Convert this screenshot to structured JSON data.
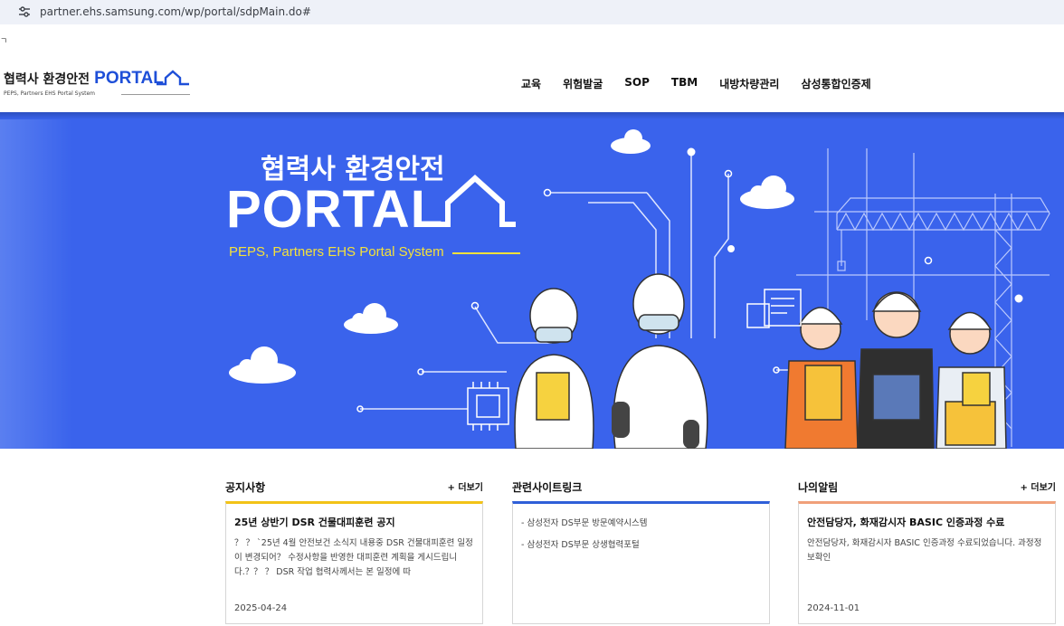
{
  "browser": {
    "url": "partner.ehs.samsung.com/wp/portal/sdpMain.do#",
    "bookmark_fragment": "ㄱ"
  },
  "header": {
    "logo_ko": "협력사 환경안전",
    "logo_portal": "PORTAL",
    "logo_sub": "PEPS, Partners EHS Portal System",
    "nav": [
      "교육",
      "위험발굴",
      "SOP",
      "TBM",
      "내방차량관리",
      "삼성통합인증제"
    ]
  },
  "hero": {
    "title_ko": "협력사 환경안전",
    "title_portal": "PORTAL",
    "subtitle": "PEPS, Partners EHS Portal System"
  },
  "notice": {
    "title": "공지사항",
    "more": "+ 더보기",
    "item_title": "25년 상반기 DSR 건물대피훈련 공지",
    "item_body": "？ ？ `25년 4월 안전보건 소식지 내용중 DSR 건물대피훈련 일정이 변경되어？ 수정사항을 반영한 대피훈련 계획을 게시드립니다.？？ ？ DSR 작업 협력사께서는 본 일정에 따",
    "date": "2025-04-24",
    "accent": "#f2c318"
  },
  "links": {
    "title": "관련사이트링크",
    "items": [
      "- 삼성전자 DS부문 방문예약시스템",
      "- 삼성전자 DS부문 상생협력포털"
    ],
    "accent": "#2f5fd8"
  },
  "alerts": {
    "title": "나의알림",
    "more": "+ 더보기",
    "item_title": "안전담당자, 화재감시자 BASIC 인증과정 수료",
    "item_body": "안전담당자, 화재감시자 BASIC 인증과정 수료되었습니다. 과정정보확인",
    "date": "2024-11-01",
    "accent": "#f0a07a"
  },
  "colors": {
    "hero_bg": "#3a63ec",
    "brand_blue": "#1e4fd8",
    "sub_yellow": "#f4e13a"
  },
  "icons": [
    "site-settings-icon",
    "house-logo-icon"
  ]
}
